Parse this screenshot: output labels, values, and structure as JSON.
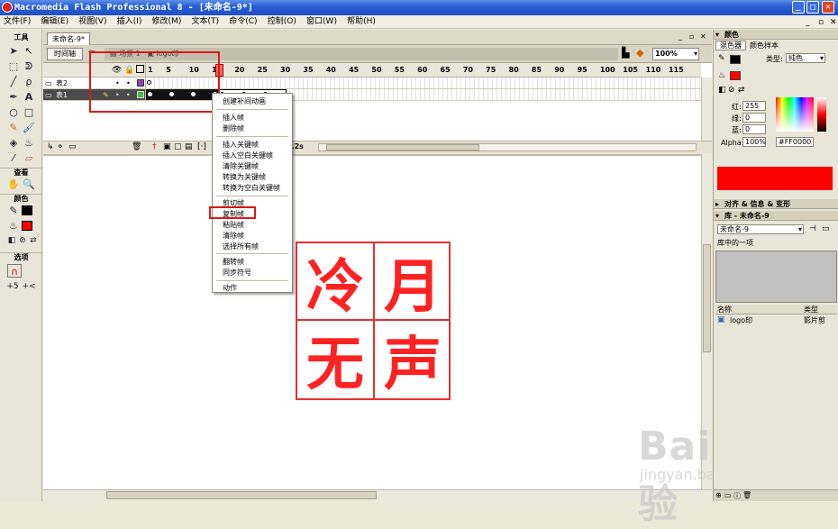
{
  "window": {
    "title": "Macromedia Flash Professional 8 - [未命名-9*]"
  },
  "menu": [
    "文件(F)",
    "编辑(E)",
    "视图(V)",
    "插入(I)",
    "修改(M)",
    "文本(T)",
    "命令(C)",
    "控制(O)",
    "窗口(W)",
    "帮助(H)"
  ],
  "tools": {
    "title": "工具",
    "view_title": "查看",
    "color_title": "颜色",
    "options_title": "选项",
    "items": [
      "selection-tool",
      "subselection-tool",
      "free-transform-tool",
      "lasso-tool",
      "line-tool",
      "pen-tool",
      "text-tool",
      "oval-tool",
      "rectangle-tool",
      "pencil-tool",
      "brush-tool",
      "ink-bottle-tool",
      "paint-bucket-tool",
      "eyedropper-tool",
      "eraser-tool"
    ],
    "stroke_color": "#000000",
    "fill_color": "#ff0000"
  },
  "document": {
    "tab": "未命名-9*"
  },
  "timeline": {
    "button": "时间轴",
    "crumbs": [
      "场景 1",
      "logo印"
    ],
    "zoom": "100%",
    "frame_numbers": [
      "1",
      "5",
      "10",
      "15",
      "20",
      "25",
      "30",
      "35",
      "40",
      "45",
      "50",
      "55",
      "60",
      "65",
      "70",
      "75",
      "80",
      "85",
      "90",
      "95",
      "100",
      "105",
      "110",
      "115"
    ],
    "layers": [
      {
        "name": "表2",
        "color": "#9040c0",
        "selected": false
      },
      {
        "name": "表1",
        "color": "#40c040",
        "selected": true
      }
    ],
    "footer_time": "1.2s"
  },
  "context_menu": {
    "groups": [
      [
        "创建补间动画"
      ],
      [
        "插入帧",
        "删除帧"
      ],
      [
        "插入关键帧",
        "插入空白关键帧",
        "清除关键帧",
        "转换为关键帧",
        "转换为空白关键帧"
      ],
      [
        "剪切帧",
        "复制帧",
        "粘贴帧",
        "清除帧",
        "选择所有帧"
      ],
      [
        "翻转帧",
        "同步符号"
      ],
      [
        "动作"
      ]
    ],
    "highlighted": "复制帧"
  },
  "stage": {
    "seal_chars": [
      "冷",
      "月",
      "无",
      "声"
    ],
    "seal_color": "#ff2222"
  },
  "color_panel": {
    "title": "颜色",
    "tabs": [
      "混色器",
      "颜色样本"
    ],
    "type_label": "类型:",
    "type_value": "纯色",
    "red_label": "红:",
    "red_value": "255",
    "green_label": "绿:",
    "green_value": "0",
    "blue_label": "蓝:",
    "blue_value": "0",
    "alpha_label": "Alpha:",
    "alpha_value": "100%",
    "hex_value": "#FF0000",
    "swatch": "#ff0000"
  },
  "align_panel": {
    "title": "对齐 & 信息 & 变形"
  },
  "library_panel": {
    "title": "库 - 未命名-9",
    "doc_select": "未命名-9",
    "count_text": "库中的一项",
    "col_name": "名称",
    "col_type": "类型",
    "items": [
      {
        "name": "logo印",
        "type": "影片剪"
      }
    ]
  },
  "watermark": {
    "text": "Baidu经验",
    "url": "jingyan.baidu.com"
  }
}
